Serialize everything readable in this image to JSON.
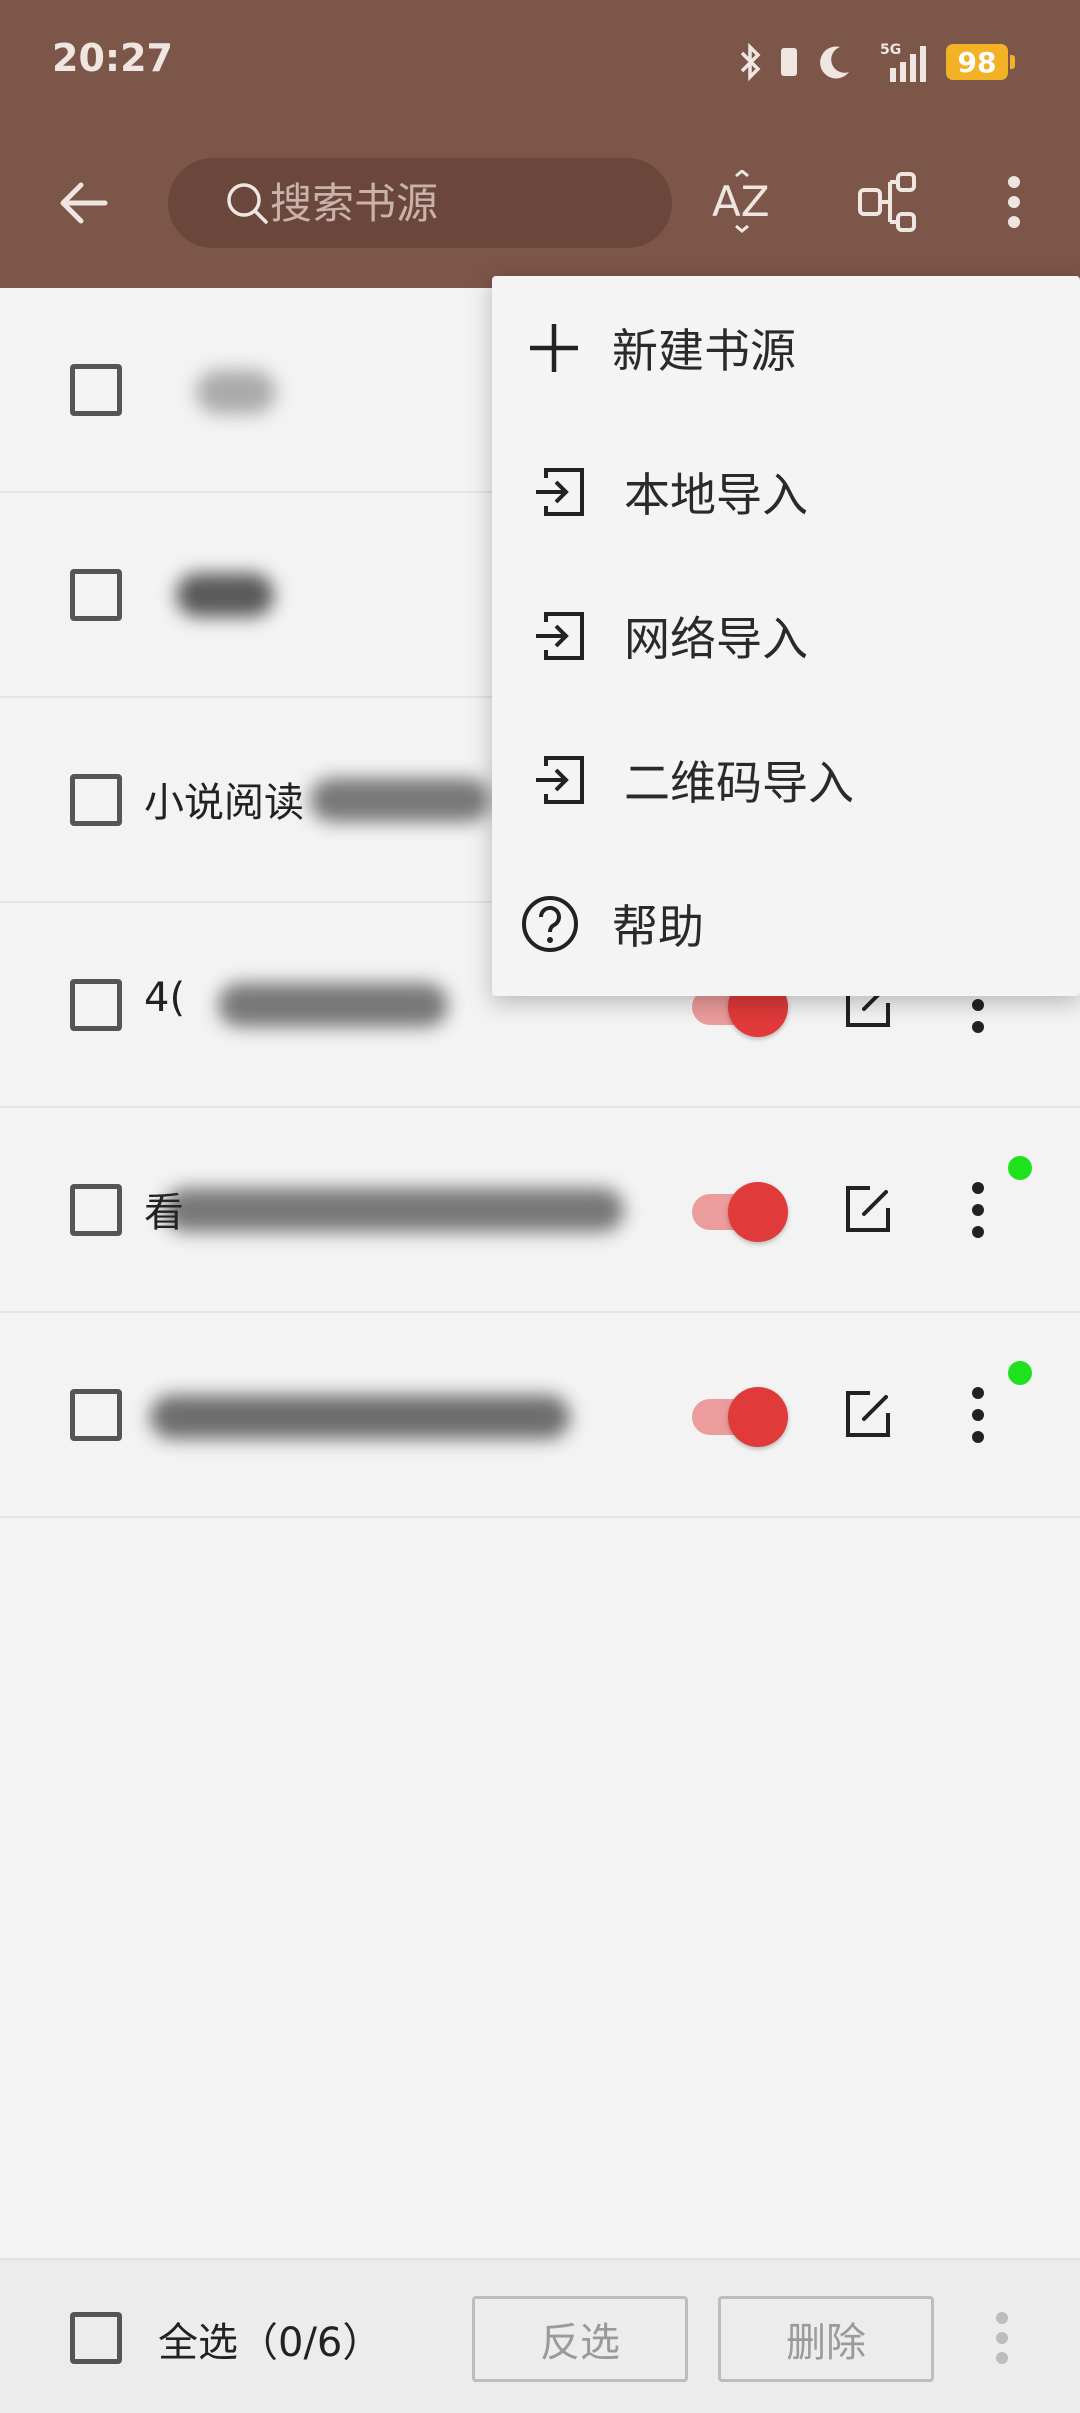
{
  "status_bar": {
    "time": "20:27",
    "network": "5G",
    "battery": "98"
  },
  "toolbar": {
    "search_placeholder": "搜索书源",
    "sort_icon_text": "AZ"
  },
  "list": {
    "rows": [
      {
        "title": "",
        "has_toggle": false
      },
      {
        "title": "",
        "has_toggle": false
      },
      {
        "title": "小说阅读",
        "has_toggle": false
      },
      {
        "title": "4(",
        "has_toggle": true,
        "enabled": true,
        "status_dot": false
      },
      {
        "title": "看",
        "has_toggle": true,
        "enabled": true,
        "status_dot": true
      },
      {
        "title": "",
        "has_toggle": true,
        "enabled": true,
        "status_dot": true
      }
    ]
  },
  "menu": {
    "items": [
      {
        "label": "新建书源",
        "icon": "plus-icon"
      },
      {
        "label": "本地导入",
        "icon": "import-icon"
      },
      {
        "label": "网络导入",
        "icon": "import-icon"
      },
      {
        "label": "二维码导入",
        "icon": "import-icon"
      },
      {
        "label": "帮助",
        "icon": "help-icon"
      }
    ]
  },
  "bottom_bar": {
    "select_all_label": "全选（0/6）",
    "invert_label": "反选",
    "delete_label": "删除"
  },
  "colors": {
    "appbar": "#7c5649",
    "toggle_on": "#e03a3a",
    "status_dot": "#1fe21f"
  }
}
